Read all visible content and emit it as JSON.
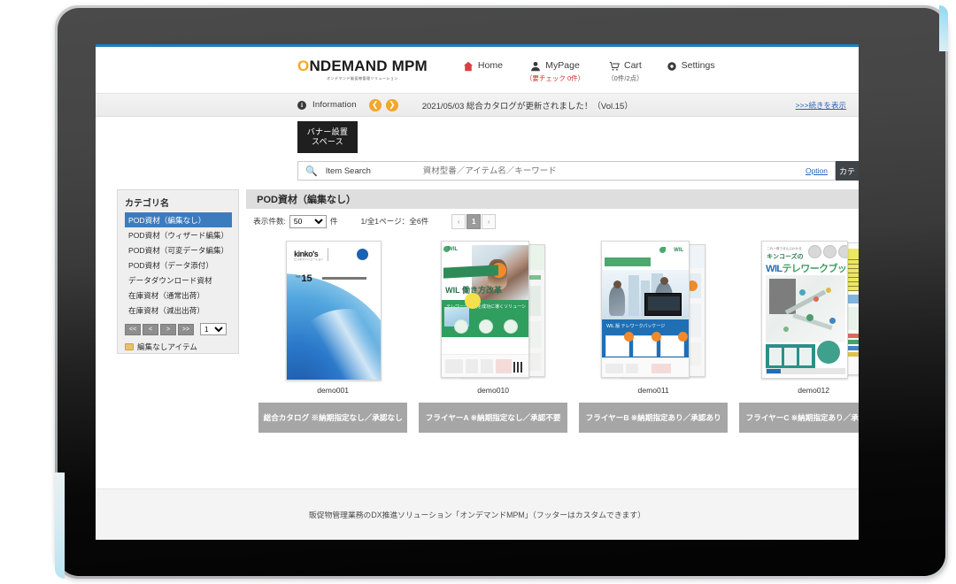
{
  "header": {
    "brand_main": "ONDEMAND MPM",
    "brand_o": "O",
    "brand_rest": "NDEMAND MPM",
    "brand_sub": "オンデマンド販促物管理ソリューション",
    "nav": [
      {
        "label": "Home",
        "icon": "home-icon",
        "sub": ""
      },
      {
        "label": "MyPage",
        "icon": "user-icon",
        "sub": "（要チェック 0件）"
      },
      {
        "label": "Cart",
        "icon": "cart-icon",
        "sub": "（0件/2点）"
      },
      {
        "label": "Settings",
        "icon": "gear-icon",
        "sub": ""
      }
    ]
  },
  "info": {
    "icon": "info-icon",
    "label": "Information",
    "prev_arrow": "❮",
    "next_arrow": "❯",
    "message": "2021/05/03 総合カタログが更新されました！（Vol.15）",
    "more_link": ">>>続きを表示"
  },
  "banner": {
    "line1": "バナー設置",
    "line2": "スペース"
  },
  "search": {
    "icon": "search-icon",
    "label": "Item Search",
    "placeholder": "資材型番／アイテム名／キーワード",
    "option_link": "Option",
    "option_icon": "filter-icon",
    "category_button": "カテ"
  },
  "sidebar": {
    "title": "カテゴリ名",
    "items": [
      {
        "label": "POD資材（編集なし）",
        "selected": true
      },
      {
        "label": "POD資材（ウィザード編集）",
        "selected": false
      },
      {
        "label": "POD資材（可変データ編集）",
        "selected": false
      },
      {
        "label": "POD資材（データ添付）",
        "selected": false
      },
      {
        "label": "データダウンロード資材",
        "selected": false
      },
      {
        "label": "在庫資材（通常出荷）",
        "selected": false
      },
      {
        "label": "在庫資材（減出出荷）",
        "selected": false
      }
    ],
    "pager": [
      "<<",
      "<",
      ">",
      ">>"
    ],
    "page_value": "1",
    "folder_item": "編集なしアイテム",
    "folder_icon": "folder-icon"
  },
  "main": {
    "section_title": "POD資材（編集なし）",
    "rows_label": "表示件数:",
    "rows_value": "50",
    "rows_unit": "件",
    "page_info": "1/全1ページ：全6件",
    "pager": {
      "prev": "‹",
      "current": "1",
      "next": "›"
    },
    "products": [
      {
        "name": "demo001",
        "caption": "総合カタログ ※納期指定なし／承認なし",
        "thumb": "kinkos-catalog",
        "logo": "kinko's",
        "logo_sub": "ビジネスソリューション",
        "vol_prefix": "vol.",
        "vol": "15",
        "tagline": "総合カタログ 2021年版"
      },
      {
        "name": "demo010",
        "caption": "フライヤーA ※納期指定なし／承認不要",
        "thumb": "green-flyer",
        "logo": "WIL",
        "title": "WIL 働き方改革",
        "band_text": "テレワーク導入を成功に導くソリューション"
      },
      {
        "name": "demo011",
        "caption": "フライヤーB ※納期指定あり／承認あり",
        "thumb": "blue-flyer",
        "logo": "WIL",
        "band_text": "WIL 版 テレワークパッケージ"
      },
      {
        "name": "demo012",
        "caption": "フライヤーC ※納期指定あり／承認不要",
        "thumb": "telework-book",
        "kicker": "これ一冊でぜんぶわかる",
        "sub_title": "キンコーズの",
        "title_blue": "WIL",
        "title_green": "テレワークブック"
      }
    ]
  },
  "footer": {
    "text": "販促物管理業務のDX推進ソリューション「オンデマンドMPM」（フッターはカスタムできます）"
  },
  "colors": {
    "accent_blue": "#1b7fc4",
    "brand_orange": "#f5a81c",
    "selected_blue": "#3d7bbf",
    "caption_gray": "#a6a6a6",
    "red_alert": "#cf2b2b"
  }
}
